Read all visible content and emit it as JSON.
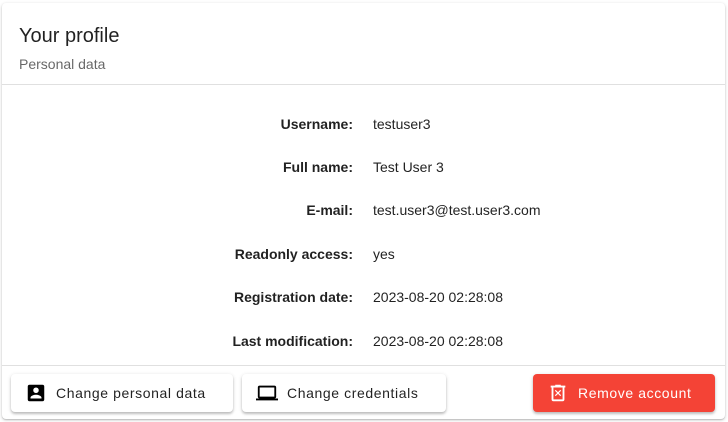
{
  "header": {
    "title": "Your profile",
    "subtitle": "Personal data"
  },
  "profile": {
    "rows": [
      {
        "label": "Username:",
        "value": "testuser3"
      },
      {
        "label": "Full name:",
        "value": "Test User 3"
      },
      {
        "label": "E-mail:",
        "value": "test.user3@test.user3.com"
      },
      {
        "label": "Readonly access:",
        "value": "yes"
      },
      {
        "label": "Registration date:",
        "value": "2023-08-20 02:28:08"
      },
      {
        "label": "Last modification:",
        "value": "2023-08-20 02:28:08"
      }
    ]
  },
  "actions": {
    "change_personal_label": "Change personal data",
    "change_personal_icon": "account-box-icon",
    "change_credentials_label": "Change credentials",
    "change_credentials_icon": "laptop-icon",
    "remove_label": "Remove account",
    "remove_icon": "delete-icon"
  },
  "colors": {
    "danger": "#f44336",
    "divider": "#e0e0e0"
  }
}
